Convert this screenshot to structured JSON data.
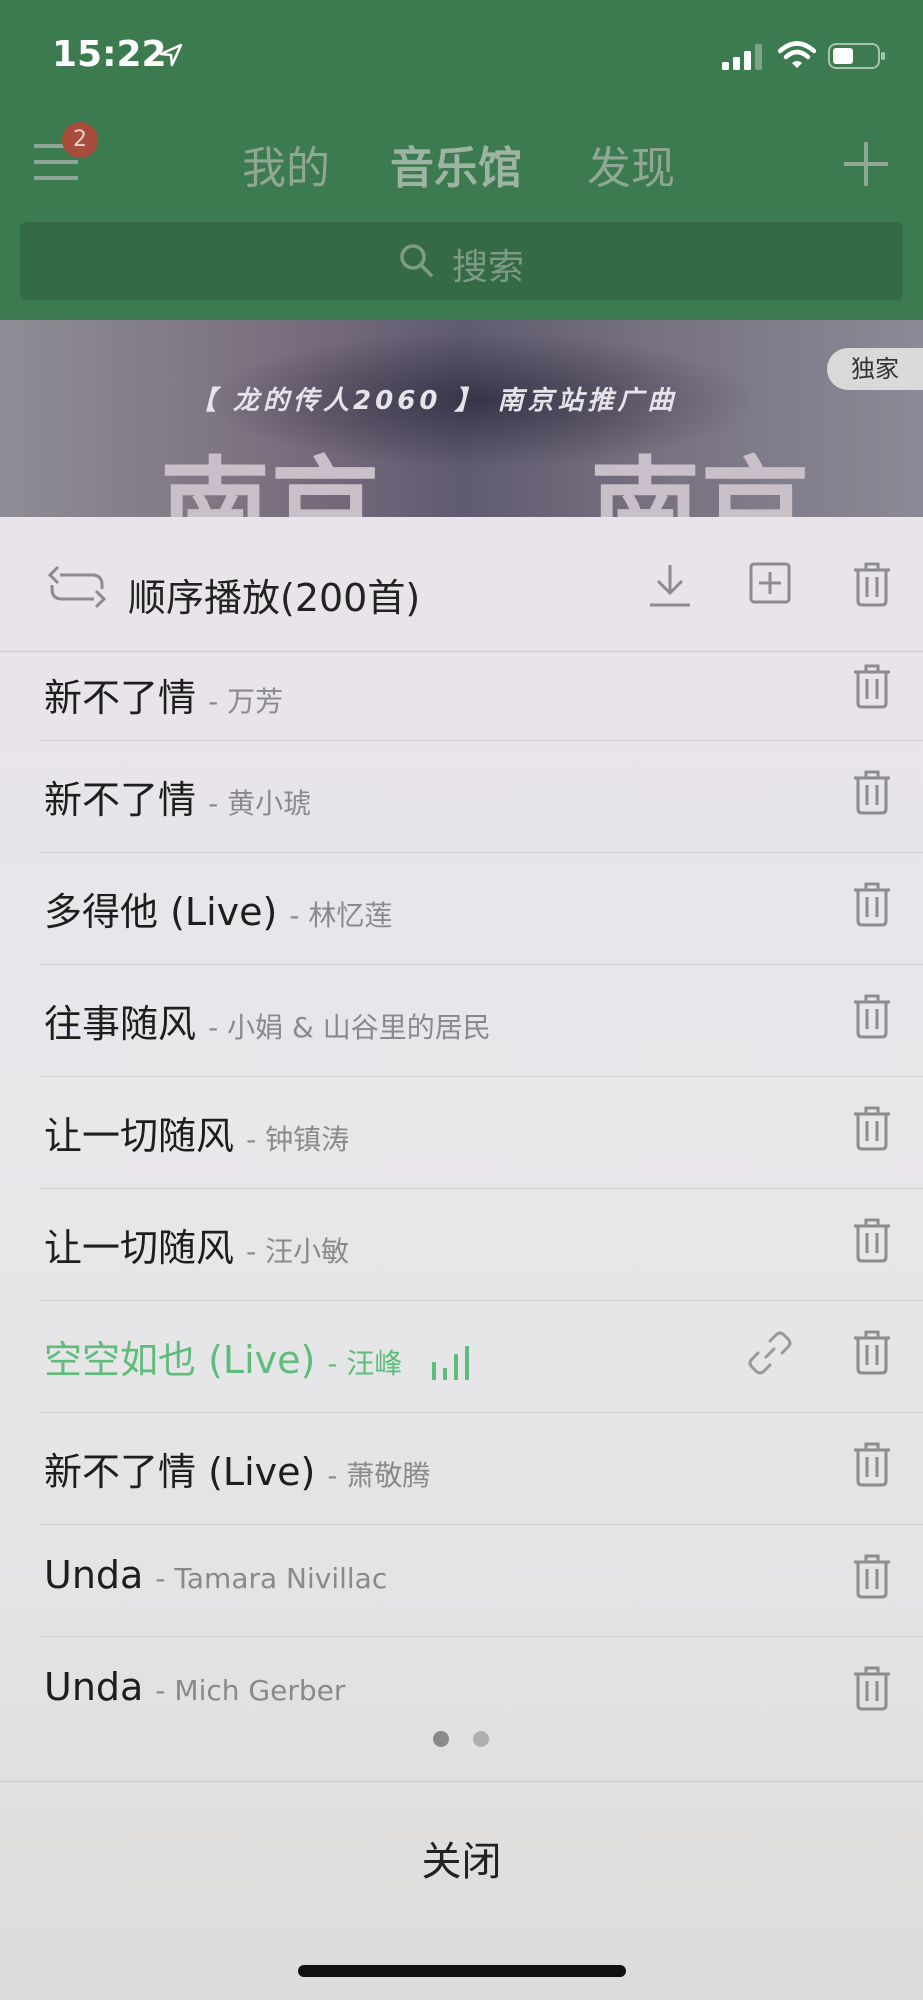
{
  "status": {
    "time": "15:22"
  },
  "header": {
    "menu_badge": "2",
    "tabs": [
      {
        "label": "我的"
      },
      {
        "label": "音乐馆"
      },
      {
        "label": "发现"
      }
    ],
    "active_tab": "音乐馆",
    "search": {
      "placeholder": "搜索"
    }
  },
  "banner": {
    "subtitle": "【 龙的传人2060 】 南京站推广曲",
    "big_left": "南京",
    "big_right": "南京",
    "badge": "独家"
  },
  "playlist": {
    "mode_label": "顺序播放(200首)",
    "songs": [
      {
        "title": "新不了情",
        "artist": "- 万芳"
      },
      {
        "title": "新不了情",
        "artist": "- 黄小琥"
      },
      {
        "title": "多得他 (Live)",
        "artist": "- 林忆莲"
      },
      {
        "title": "往事随风",
        "artist": "- 小娟 & 山谷里的居民"
      },
      {
        "title": "让一切随风",
        "artist": "- 钟镇涛"
      },
      {
        "title": "让一切随风",
        "artist": "- 汪小敏"
      },
      {
        "title": "空空如也 (Live)",
        "artist": "- 汪峰",
        "playing": true
      },
      {
        "title": "新不了情 (Live)",
        "artist": "- 萧敬腾"
      },
      {
        "title": "Unda",
        "artist": "- Tamara Nivillac"
      },
      {
        "title": "Unda",
        "artist": "- Mich Gerber"
      }
    ],
    "page_count": 2,
    "current_page": 1,
    "close_label": "关闭"
  },
  "colors": {
    "header_green": "#3c7a4f",
    "playing_green": "#5fbd7c"
  },
  "icons": [
    "location-arrow-icon",
    "signal-icon",
    "wifi-icon",
    "battery-icon",
    "menu-icon",
    "plus-icon",
    "search-icon",
    "repeat-icon",
    "download-icon",
    "add-to-list-icon",
    "trash-icon",
    "link-icon",
    "equalizer-icon"
  ]
}
